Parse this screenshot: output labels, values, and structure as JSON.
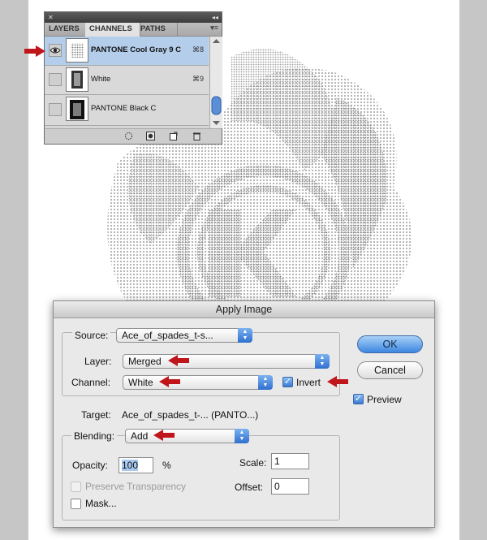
{
  "channels_panel": {
    "tabs": [
      {
        "label": "LAYERS",
        "active": false
      },
      {
        "label": "CHANNELS",
        "active": true
      },
      {
        "label": "PATHS",
        "active": false
      }
    ],
    "menu_glyph": "▾≡",
    "collapse_glyph": "◂◂",
    "close_glyph": "✕",
    "rows": [
      {
        "name": "PANTONE Cool Gray 9 C",
        "shortcut": "⌘8",
        "selected": true,
        "visible": true
      },
      {
        "name": "White",
        "shortcut": "⌘9",
        "selected": false,
        "visible": false
      },
      {
        "name": "PANTONE Black C",
        "shortcut": "",
        "selected": false,
        "visible": false
      }
    ],
    "footer_icons": [
      "load-selection-icon",
      "save-selection-icon",
      "new-channel-icon",
      "delete-channel-icon"
    ]
  },
  "dialog": {
    "title": "Apply Image",
    "source_label": "Source:",
    "source_value": "Ace_of_spades_t-s...",
    "layer_label": "Layer:",
    "layer_value": "Merged",
    "channel_label": "Channel:",
    "channel_value": "White",
    "invert_label": "Invert",
    "invert_checked": true,
    "target_label": "Target:",
    "target_value": "Ace_of_spades_t-... (PANTO...)",
    "blending_label": "Blending:",
    "blending_value": "Add",
    "opacity_label": "Opacity:",
    "opacity_value": "100",
    "opacity_unit": "%",
    "scale_label": "Scale:",
    "scale_value": "1",
    "offset_label": "Offset:",
    "offset_value": "0",
    "preserve_label": "Preserve Transparency",
    "preserve_checked": false,
    "mask_label": "Mask...",
    "mask_checked": false,
    "ok_label": "OK",
    "cancel_label": "Cancel",
    "preview_label": "Preview",
    "preview_checked": true,
    "check_glyph": "✓"
  },
  "colors": {
    "annotation_arrow": "#c0161b",
    "selection": "#b4cdea",
    "accent": "#3d86e0"
  }
}
